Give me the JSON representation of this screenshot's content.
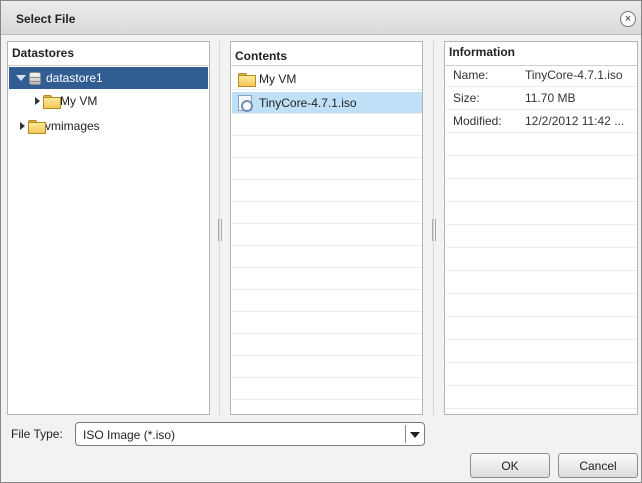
{
  "dialog": {
    "title": "Select File",
    "close_glyph": "×"
  },
  "datastores": {
    "header": "Datastores",
    "tree": [
      {
        "label": "datastore1",
        "icon": "datastore-icon",
        "expanded": true,
        "selected": true,
        "level": 0
      },
      {
        "label": "My VM",
        "icon": "folder-icon",
        "expanded": false,
        "selected": false,
        "level": 1
      },
      {
        "label": "vmimages",
        "icon": "folder-icon",
        "expanded": false,
        "selected": false,
        "level": 0
      }
    ]
  },
  "contents": {
    "header": "Contents",
    "items": [
      {
        "label": "My VM",
        "icon": "folder-icon",
        "selected": false
      },
      {
        "label": "TinyCore-4.7.1.iso",
        "icon": "disc-image-icon",
        "selected": true
      }
    ]
  },
  "information": {
    "header": "Information",
    "rows": [
      {
        "key": "Name:",
        "value": "TinyCore-4.7.1.iso"
      },
      {
        "key": "Size:",
        "value": "11.70 MB"
      },
      {
        "key": "Modified:",
        "value": "12/2/2012 11:42 ..."
      }
    ]
  },
  "file_type": {
    "label": "File Type:",
    "selected": "ISO Image (*.iso)"
  },
  "buttons": {
    "ok": "OK",
    "cancel": "Cancel"
  },
  "colors": {
    "tree_selection": "#315d93",
    "list_selection": "#bfe0f7"
  }
}
